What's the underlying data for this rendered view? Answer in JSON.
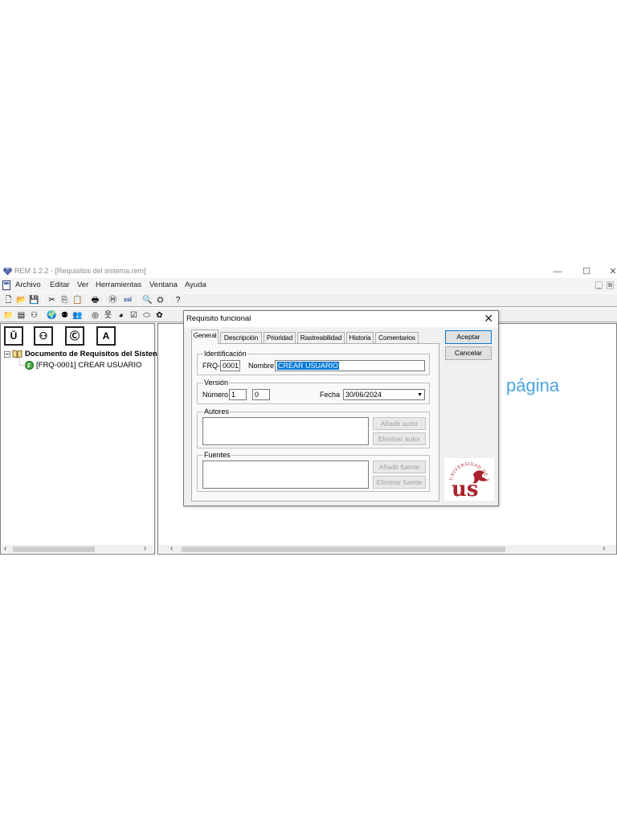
{
  "window": {
    "title": "REM 1.2.2 - [Requisitos del sistema.rem]",
    "controls": {
      "minimize": "—",
      "maximize": "☐",
      "close": "✕",
      "mdi_min": "_",
      "mdi_restore": "⧉"
    }
  },
  "menu": [
    "Archivo",
    "Editar",
    "Ver",
    "Herramientas",
    "Ventana",
    "Ayuda"
  ],
  "toolbar1": [
    {
      "icon": "new-document-icon",
      "glyph": "🗋"
    },
    {
      "icon": "open-folder-icon",
      "glyph": "📂"
    },
    {
      "icon": "save-icon",
      "glyph": "💾"
    },
    {
      "icon": "cut-icon",
      "glyph": "✂"
    },
    {
      "icon": "copy-icon",
      "glyph": "⎘"
    },
    {
      "icon": "paste-icon",
      "glyph": "📋"
    },
    {
      "icon": "print-icon",
      "glyph": "🖶"
    },
    {
      "icon": "html-export-icon",
      "glyph": "Ⓗ"
    },
    {
      "icon": "xsl-icon",
      "glyph": "xsl"
    },
    {
      "icon": "find-icon",
      "glyph": "🔍"
    },
    {
      "icon": "replace-icon",
      "glyph": "⛭"
    },
    {
      "icon": "help-icon",
      "glyph": "?"
    }
  ],
  "toolbar2": [
    {
      "icon": "new-folder-icon",
      "glyph": "📁"
    },
    {
      "icon": "list-icon",
      "glyph": "▤"
    },
    {
      "icon": "organization-icon",
      "glyph": "⚇"
    },
    {
      "icon": "globe-icon",
      "glyph": "🌍"
    },
    {
      "icon": "stakeholders-icon",
      "glyph": "⚉"
    },
    {
      "icon": "people-icon",
      "glyph": "👥"
    },
    {
      "icon": "target-icon",
      "glyph": "◎"
    },
    {
      "icon": "actor-icon",
      "glyph": "웃"
    },
    {
      "icon": "ball-icon",
      "glyph": "◕"
    },
    {
      "icon": "checklist-icon",
      "glyph": "☑"
    },
    {
      "icon": "ellipse-icon",
      "glyph": "⬭"
    },
    {
      "icon": "gear-icon",
      "glyph": "✿"
    }
  ],
  "tree": {
    "expander": "−",
    "root_label": "Documento de Requisitos del Sisten",
    "child_badge": "F",
    "child_label": "[FRQ-0001] CREAR USUARIO"
  },
  "view_tabs": [
    "Ŭ",
    "⚇",
    "Ⓒ",
    "A"
  ],
  "scroll": {
    "left": "‹",
    "right": "›"
  },
  "background_text": "página",
  "dialog": {
    "title": "Requisito funcional",
    "close": "✕",
    "tabs": [
      "General",
      "Descripción",
      "Prioridad",
      "Rastreabilidad",
      "Historia",
      "Comentarios"
    ],
    "identificacion": {
      "legend": "Identificación",
      "prefix": "FRQ-",
      "id_value": "0001",
      "nombre_label": "Nombre",
      "nombre_value": "CREAR USUARIO"
    },
    "version": {
      "legend": "Versión",
      "numero_label": "Número",
      "major": "1",
      "minor": "0",
      "fecha_label": "Fecha",
      "fecha_value": "30/06/2024",
      "dropdown_arrow": "▼"
    },
    "autores": {
      "legend": "Autores",
      "add": "Añadir autor",
      "remove": "Eliminar autor"
    },
    "fuentes": {
      "legend": "Fuentes",
      "add": "Añadir fuente",
      "remove": "Eliminar fuente"
    },
    "buttons": {
      "accept": "Aceptar",
      "cancel": "Cancelar"
    },
    "logo": {
      "text": "UNIVERSIDAD DE SEVILLA",
      "letters": "us"
    }
  },
  "colors": {
    "selection": "#0078d7",
    "accent_text": "#4aa3df",
    "logo": "#a8232d"
  }
}
